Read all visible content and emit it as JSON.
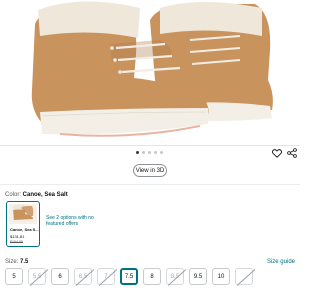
{
  "product": {
    "image_alt": "Sorel boots",
    "carousel_dots": 5,
    "active_dot": 0,
    "view_3d_label": "View in 3D"
  },
  "colors": {
    "boot_upper": "#c9935e",
    "boot_shade": "#b07a47",
    "fleece": "#efe7da",
    "sole": "#f4efe6",
    "sole_accent": "#e8b4a3",
    "link": "#007185",
    "selected_border": "#007185"
  },
  "variant": {
    "color_label": "Color: ",
    "color_value": "Canoe, Sea Salt",
    "swatch": {
      "name": "Canoe, Sea S...",
      "price": "$131.81",
      "old_price": "$164.95"
    },
    "offers_text": "See 2 options with no featured offers"
  },
  "size": {
    "label": "Size: ",
    "value": "7.5",
    "guide_label": "Size guide",
    "options": [
      {
        "label": "5",
        "available": true,
        "selected": false
      },
      {
        "label": "5.5",
        "available": false,
        "selected": false
      },
      {
        "label": "6",
        "available": true,
        "selected": false
      },
      {
        "label": "6.5",
        "available": false,
        "selected": false
      },
      {
        "label": "7",
        "available": false,
        "selected": false
      },
      {
        "label": "7.5",
        "available": true,
        "selected": true
      },
      {
        "label": "8",
        "available": true,
        "selected": false
      },
      {
        "label": "8.5",
        "available": false,
        "selected": false
      },
      {
        "label": "9.5",
        "available": true,
        "selected": false
      },
      {
        "label": "10",
        "available": true,
        "selected": false
      },
      {
        "label": "",
        "available": false,
        "selected": false
      }
    ]
  },
  "icons": {
    "favorite": "heart-icon",
    "share": "share-icon"
  }
}
